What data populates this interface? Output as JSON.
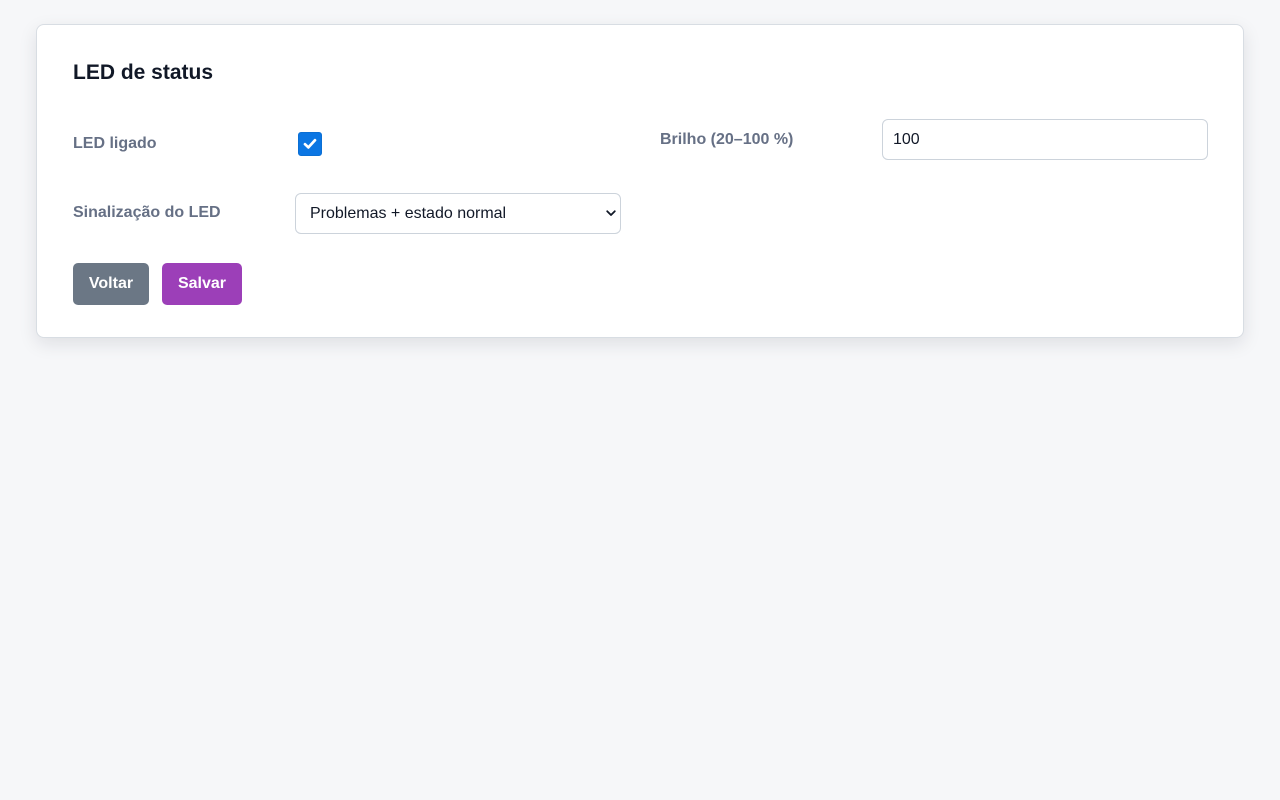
{
  "card": {
    "title": "LED de status"
  },
  "fields": {
    "led_on": {
      "label": "LED ligado",
      "checked": true
    },
    "brightness": {
      "label": "Brilho (20–100 %)",
      "value": "100"
    },
    "signaling": {
      "label": "Sinalização do LED",
      "selected": "Problemas + estado normal"
    }
  },
  "buttons": {
    "back_label": "Voltar",
    "save_label": "Salvar"
  },
  "colors": {
    "background": "#f6f7f9",
    "checkbox": "#0b76e3",
    "back_button": "#6b7785",
    "save_button": "#9c3fb8",
    "label": "#667085"
  },
  "icons": {
    "checkbox": "check-icon",
    "select": "chevron-down-icon"
  }
}
